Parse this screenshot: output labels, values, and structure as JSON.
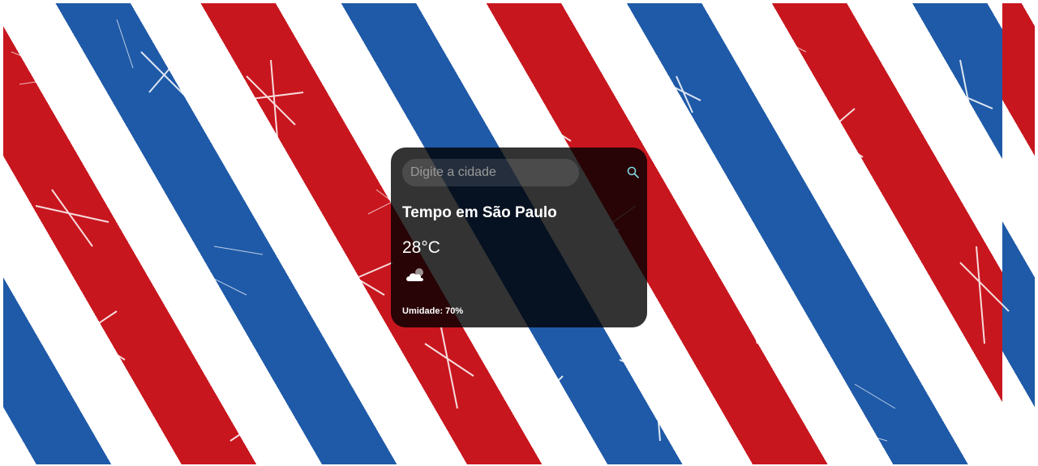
{
  "search": {
    "placeholder": "Digite a cidade",
    "value": ""
  },
  "weather": {
    "title": "Tempo em São Paulo",
    "temperature": "28°C",
    "condition_icon": "partly-cloudy-icon",
    "humidity": "Umidade: 70%"
  },
  "background": {
    "pattern": "diagonal-stripes",
    "colors": [
      "#ffffff",
      "#1f5aa8",
      "#c8161e"
    ]
  },
  "card": {
    "background": "#000000cc",
    "text_color": "#ffffff"
  }
}
